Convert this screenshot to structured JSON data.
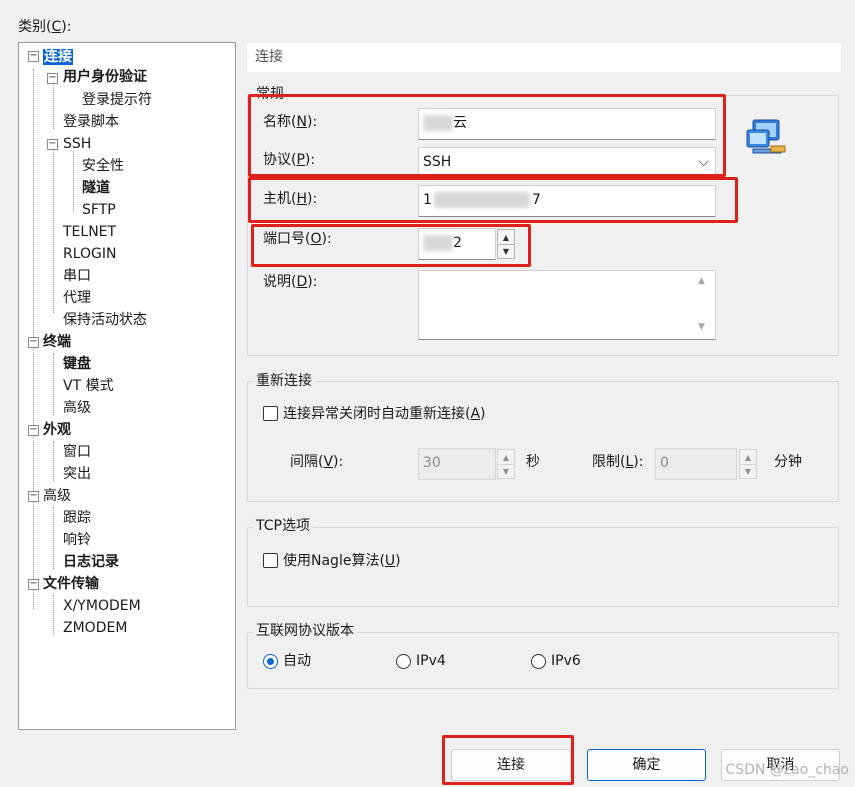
{
  "category": {
    "label": "类别(",
    "mnemonic": "C",
    "label_end": "):",
    "tree": [
      {
        "text": "连接",
        "selected": true,
        "bold": true
      },
      {
        "text": "用户身份验证",
        "bold": true
      },
      {
        "text": "登录提示符"
      },
      {
        "text": "登录脚本"
      },
      {
        "text": "SSH"
      },
      {
        "text": "安全性"
      },
      {
        "text": "隧道",
        "bold": true
      },
      {
        "text": "SFTP"
      },
      {
        "text": "TELNET"
      },
      {
        "text": "RLOGIN"
      },
      {
        "text": "串口"
      },
      {
        "text": "代理"
      },
      {
        "text": "保持活动状态"
      },
      {
        "text": "终端",
        "bold": true
      },
      {
        "text": "键盘",
        "bold": true
      },
      {
        "text": "VT 模式"
      },
      {
        "text": "高级"
      },
      {
        "text": "外观",
        "bold": true
      },
      {
        "text": "窗口"
      },
      {
        "text": "突出"
      },
      {
        "text": "高级"
      },
      {
        "text": "跟踪"
      },
      {
        "text": "响铃"
      },
      {
        "text": "日志记录",
        "bold": true
      },
      {
        "text": "文件传输",
        "bold": true
      },
      {
        "text": "X/YMODEM"
      },
      {
        "text": "ZMODEM"
      }
    ]
  },
  "page_heading": "连接",
  "general": {
    "legend": "常规",
    "name_label": "名称(",
    "name_key": "N",
    "name_end": "):",
    "name_value_visible": "云",
    "protocol_label": "协议(",
    "protocol_key": "P",
    "protocol_end": "):",
    "protocol_value": "SSH",
    "host_label": "主机(",
    "host_key": "H",
    "host_end": "):",
    "host_value_start": "1",
    "host_value_end": "7",
    "port_label": "端口号(",
    "port_key": "O",
    "port_end": "):",
    "port_value_partial": "2",
    "desc_label": "说明(",
    "desc_key": "D",
    "desc_end": "):",
    "desc_value": ""
  },
  "reconnect": {
    "legend": "重新连接",
    "checkbox_label": "连接异常关闭时自动重新连接(",
    "checkbox_key": "A",
    "checkbox_end": ")",
    "checked": false,
    "interval_label": "间隔(",
    "interval_key": "V",
    "interval_end": "):",
    "interval_value": "30",
    "interval_unit": "秒",
    "limit_label": "限制(",
    "limit_key": "L",
    "limit_end": "):",
    "limit_value": "0",
    "limit_unit": "分钟"
  },
  "tcp": {
    "legend": "TCP选项",
    "nagle_label": "使用Nagle算法(",
    "nagle_key": "U",
    "nagle_end": ")",
    "checked": false
  },
  "ip_version": {
    "legend": "互联网协议版本",
    "options": [
      "自动",
      "IPv4",
      "IPv6"
    ],
    "selected": "自动"
  },
  "buttons": {
    "connect": "连接",
    "ok": "确定",
    "cancel": "取消"
  },
  "watermark": "CSDN @zao_chao",
  "accent_color": "#0a64d2",
  "highlight_color": "#e0201b"
}
